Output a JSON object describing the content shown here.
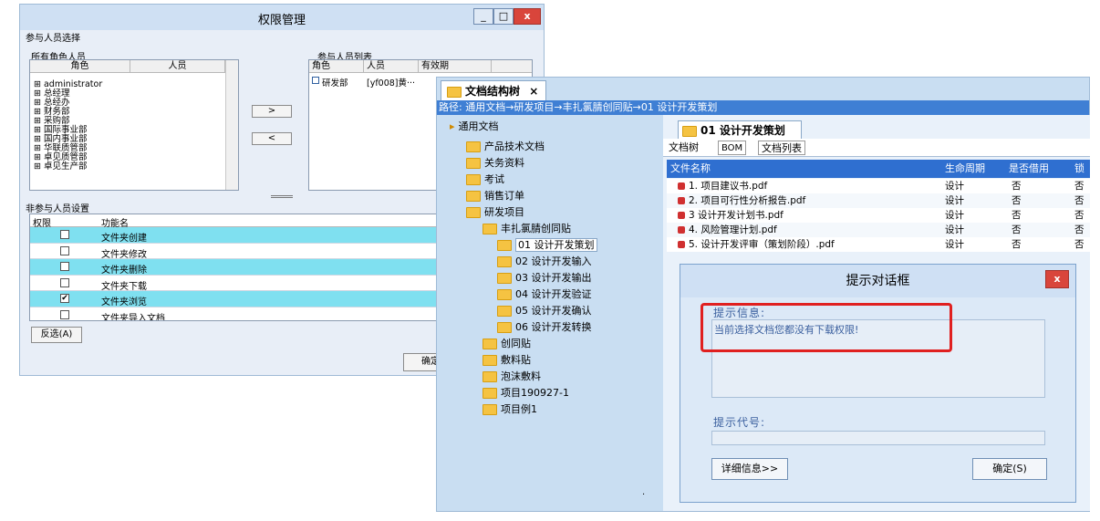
{
  "perm_window": {
    "title": "权限管理",
    "min_label": "_",
    "max_label": "□",
    "close_label": "x",
    "participants_group": "参与人员选择",
    "all_roles_label": "所有角色人员",
    "roles_table_headers": [
      "角色",
      "人员"
    ],
    "role_tree": [
      "⊞ administrator",
      "⊞ 总经理",
      "⊞ 总经办",
      "⊞ 财务部",
      "⊞ 采购部",
      "⊞ 国际事业部",
      "⊞ 国内事业部",
      "⊞ 华联质管部",
      "⊞ 卓见质管部",
      "⊞ 卓见生产部"
    ],
    "add_button": ">",
    "remove_button": "<",
    "participant_list_label": "参与人员列表",
    "participant_headers": [
      "角色",
      "人员",
      "有效期"
    ],
    "participant_rows": [
      {
        "role": "研发部",
        "person": "[yf008]黄···",
        "validity": ""
      }
    ],
    "non_participant_group": "非参与人员设置",
    "perm_headers": [
      "权限",
      "功能名"
    ],
    "perm_rows": [
      {
        "name": "文件夹创建",
        "checked": "",
        "color": "cyan"
      },
      {
        "name": "文件夹修改",
        "checked": "",
        "color": "white"
      },
      {
        "name": "文件夹删除",
        "checked": "",
        "color": "cyan"
      },
      {
        "name": "文件夹下载",
        "checked": "",
        "color": "white"
      },
      {
        "name": "文件夹浏览",
        "checked": "✔",
        "color": "cyan"
      },
      {
        "name": "文件夹导入文档",
        "checked": "",
        "color": "white"
      }
    ],
    "invert_button": "反选(A)",
    "ok_button": "确定"
  },
  "doc_window": {
    "tab_label": "文档结构树",
    "tab_close": "×",
    "path": "路径: 通用文档→研发项目→丰扎氯腈创同贴→01 设计开发策划",
    "tree_root": "通用文档",
    "tree_items": [
      {
        "label": "产品技术文档",
        "level": 1
      },
      {
        "label": "关务资料",
        "level": 1
      },
      {
        "label": "考试",
        "level": 1
      },
      {
        "label": "销售订单",
        "level": 1
      },
      {
        "label": "研发项目",
        "level": 1
      },
      {
        "label": "丰扎氯腈创同贴",
        "level": 2
      },
      {
        "label": "01 设计开发策划",
        "level": 3,
        "selected": true
      },
      {
        "label": "02 设计开发输入",
        "level": 3
      },
      {
        "label": "03 设计开发输出",
        "level": 3
      },
      {
        "label": "04 设计开发验证",
        "level": 3
      },
      {
        "label": "05 设计开发确认",
        "level": 3
      },
      {
        "label": "06 设计开发转换",
        "level": 3
      },
      {
        "label": "创同贴",
        "level": 2
      },
      {
        "label": "敷料贴",
        "level": 2
      },
      {
        "label": "泡沫敷料",
        "level": 2
      },
      {
        "label": "项目190927-1",
        "level": 2
      },
      {
        "label": "项目例1",
        "level": 2
      }
    ],
    "doc_tab_label": "01 设计开发策划",
    "doc_tab_close": "×",
    "sub_tabs": [
      "文档树",
      "BOM",
      "文档列表"
    ],
    "grid_headers": [
      "文件名称",
      "生命周期",
      "是否借用",
      "锁"
    ],
    "grid_rows": [
      {
        "name": "1. 项目建议书.pdf",
        "stage": "设计",
        "borrow": "否",
        "lock": "否"
      },
      {
        "name": "2. 项目可行性分析报告.pdf",
        "stage": "设计",
        "borrow": "否",
        "lock": "否"
      },
      {
        "name": "3 设计开发计划书.pdf",
        "stage": "设计",
        "borrow": "否",
        "lock": "否"
      },
      {
        "name": "4. 风险管理计划.pdf",
        "stage": "设计",
        "borrow": "否",
        "lock": "否"
      },
      {
        "name": "5. 设计开发评审（策划阶段）.pdf",
        "stage": "设计",
        "borrow": "否",
        "lock": "否"
      }
    ],
    "corner_mark": "."
  },
  "dialog": {
    "title": "提示对话框",
    "close_label": "x",
    "info_label": "提示信息:",
    "info_text": "当前选择文档您都没有下载权限!",
    "code_label": "提示代号:",
    "details_button": "详细信息>>",
    "ok_button": "确定(S)"
  },
  "colors": {
    "highlight_row": "#7fe0f0",
    "path_bar": "#3f7fd4",
    "grid_header": "#2f6fd0",
    "alert_box": "#e02020",
    "folder": "#f5c342"
  }
}
